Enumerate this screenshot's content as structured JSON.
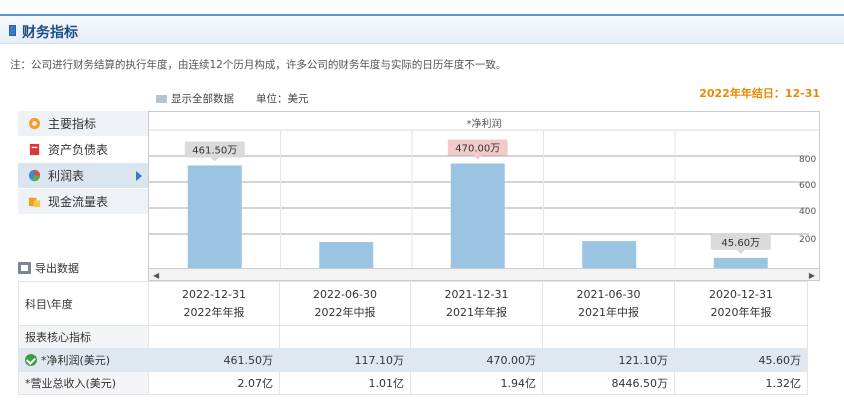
{
  "header": {
    "title": "财务指标"
  },
  "note": "注：公司进行财务结算的执行年度，由连续12个历月构成，许多公司的财务年度与实际的日历年度不一致。",
  "options": {
    "show_all": "显示全部数据",
    "unit": "单位：美元"
  },
  "fiscal_year_end": "2022年年结日：12-31",
  "sidebar": {
    "items": [
      {
        "label": "主要指标",
        "icon": "star-icon"
      },
      {
        "label": "资产负债表",
        "icon": "document-icon"
      },
      {
        "label": "利润表",
        "icon": "pie-chart-icon",
        "active": true
      },
      {
        "label": "现金流量表",
        "icon": "cash-icon"
      }
    ],
    "export_label": "导出数据"
  },
  "chart_data": {
    "type": "bar",
    "title": "*净利润",
    "categories": [
      "2022-12-31",
      "2022-06-30",
      "2021-12-31",
      "2021-06-30",
      "2020-12-31"
    ],
    "values": [
      4615000,
      1171000,
      4700000,
      1211000,
      456000
    ],
    "data_labels": [
      "461.50万",
      "",
      "470.00万",
      "",
      "45.60万"
    ],
    "y_ticks": [
      "200",
      "400",
      "600",
      "800"
    ],
    "bar_color": "#9bc3e2"
  },
  "table": {
    "header_label": "科目\\年度",
    "periods": [
      {
        "date": "2022-12-31",
        "type": "2022年年报"
      },
      {
        "date": "2022-06-30",
        "type": "2022年中报"
      },
      {
        "date": "2021-12-31",
        "type": "2021年年报"
      },
      {
        "date": "2021-06-30",
        "type": "2021年中报"
      },
      {
        "date": "2020-12-31",
        "type": "2020年年报"
      }
    ],
    "section_label": "报表核心指标",
    "rows": [
      {
        "label": "*净利润(美元)",
        "values": [
          "461.50万",
          "117.10万",
          "470.00万",
          "121.10万",
          "45.60万"
        ]
      },
      {
        "label": "*营业总收入(美元)",
        "values": [
          "2.07亿",
          "1.01亿",
          "1.94亿",
          "8446.50万",
          "1.32亿"
        ]
      }
    ]
  }
}
